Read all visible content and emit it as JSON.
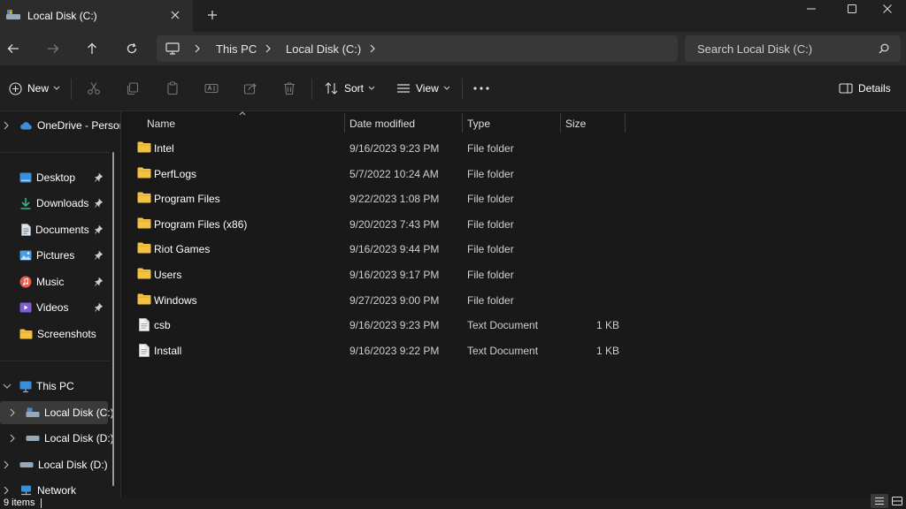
{
  "window": {
    "tab_title": "Local Disk (C:)",
    "tab_icon": "drive-icon",
    "minimize_icon": "minimize-icon",
    "maximize_icon": "maximize-icon",
    "close_icon": "close-icon"
  },
  "address": {
    "crumbs": [
      "This PC",
      "Local Disk (C:)"
    ],
    "search_placeholder": "Search Local Disk (C:)"
  },
  "toolbar": {
    "new_label": "New",
    "sort_label": "Sort",
    "view_label": "View",
    "details_label": "Details"
  },
  "sidebar": {
    "onedrive": "OneDrive - Personal",
    "quick_access": [
      {
        "label": "Desktop",
        "icon": "desktop-icon",
        "color": "#3b8fd9"
      },
      {
        "label": "Downloads",
        "icon": "download-icon",
        "color": "#2fb58f"
      },
      {
        "label": "Documents",
        "icon": "document-icon",
        "color": "#9aa6b2"
      },
      {
        "label": "Pictures",
        "icon": "pictures-icon",
        "color": "#4a9ae0"
      },
      {
        "label": "Music",
        "icon": "music-icon",
        "color": "#e35d4f"
      },
      {
        "label": "Videos",
        "icon": "videos-icon",
        "color": "#7f5cd6"
      },
      {
        "label": "Screenshots",
        "icon": "folder-icon",
        "color": "#f4c242"
      }
    ],
    "this_pc": "This PC",
    "drives": [
      "Local Disk (C:)",
      "Local Disk (D:)"
    ],
    "external": "Local Disk (D:)",
    "network": "Network"
  },
  "columns": {
    "name": "Name",
    "date": "Date modified",
    "type": "Type",
    "size": "Size"
  },
  "files": [
    {
      "name": "Intel",
      "date": "9/16/2023 9:23 PM",
      "type": "File folder",
      "size": "",
      "icon": "folder"
    },
    {
      "name": "PerfLogs",
      "date": "5/7/2022 10:24 AM",
      "type": "File folder",
      "size": "",
      "icon": "folder"
    },
    {
      "name": "Program Files",
      "date": "9/22/2023 1:08 PM",
      "type": "File folder",
      "size": "",
      "icon": "folder"
    },
    {
      "name": "Program Files (x86)",
      "date": "9/20/2023 7:43 PM",
      "type": "File folder",
      "size": "",
      "icon": "folder"
    },
    {
      "name": "Riot Games",
      "date": "9/16/2023 9:44 PM",
      "type": "File folder",
      "size": "",
      "icon": "folder"
    },
    {
      "name": "Users",
      "date": "9/16/2023 9:17 PM",
      "type": "File folder",
      "size": "",
      "icon": "folder"
    },
    {
      "name": "Windows",
      "date": "9/27/2023 9:00 PM",
      "type": "File folder",
      "size": "",
      "icon": "folder"
    },
    {
      "name": "csb",
      "date": "9/16/2023 9:23 PM",
      "type": "Text Document",
      "size": "1 KB",
      "icon": "text"
    },
    {
      "name": "Install",
      "date": "9/16/2023 9:22 PM",
      "type": "Text Document",
      "size": "1 KB",
      "icon": "text"
    }
  ],
  "status": {
    "item_count": "9 items"
  },
  "colors": {
    "folder": "#f4c242",
    "accent": "#4cc2ff"
  }
}
